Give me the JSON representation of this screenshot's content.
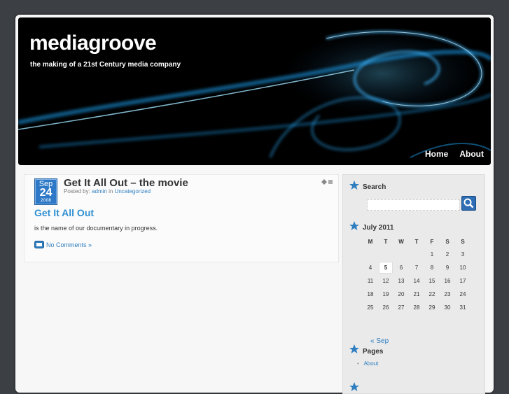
{
  "site": {
    "title": "mediagroove",
    "description": "the making of a 21st Century media company"
  },
  "nav": {
    "items": [
      "Home",
      "About"
    ]
  },
  "post": {
    "date": {
      "month": "Sep",
      "day": "24",
      "year": "2008"
    },
    "title": "Get It All Out – the movie",
    "meta_prefix": "Posted by:",
    "author": "admin",
    "meta_in": "in",
    "category": "Uncategorized",
    "subtitle": "Get It All Out",
    "body": "is the name of our documentary in progress.",
    "comments_label": "No Comments »"
  },
  "sidebar": {
    "search": {
      "title": "Search",
      "placeholder": ""
    },
    "calendar": {
      "title": "July 2011",
      "weekdays": [
        "M",
        "T",
        "W",
        "T",
        "F",
        "S",
        "S"
      ],
      "weeks": [
        [
          "",
          "",
          "",
          "",
          "1",
          "2",
          "3"
        ],
        [
          "4",
          "5",
          "6",
          "7",
          "8",
          "9",
          "10"
        ],
        [
          "11",
          "12",
          "13",
          "14",
          "15",
          "16",
          "17"
        ],
        [
          "18",
          "19",
          "20",
          "21",
          "22",
          "23",
          "24"
        ],
        [
          "25",
          "26",
          "27",
          "28",
          "29",
          "30",
          "31"
        ]
      ],
      "today": "5",
      "prev_label": "« Sep"
    },
    "pages": {
      "title": "Pages",
      "items": [
        "About"
      ]
    }
  },
  "colors": {
    "accent": "#2f7fc0",
    "background": "#3c3f44",
    "header": "#000000",
    "glow": "#1e9be8"
  }
}
